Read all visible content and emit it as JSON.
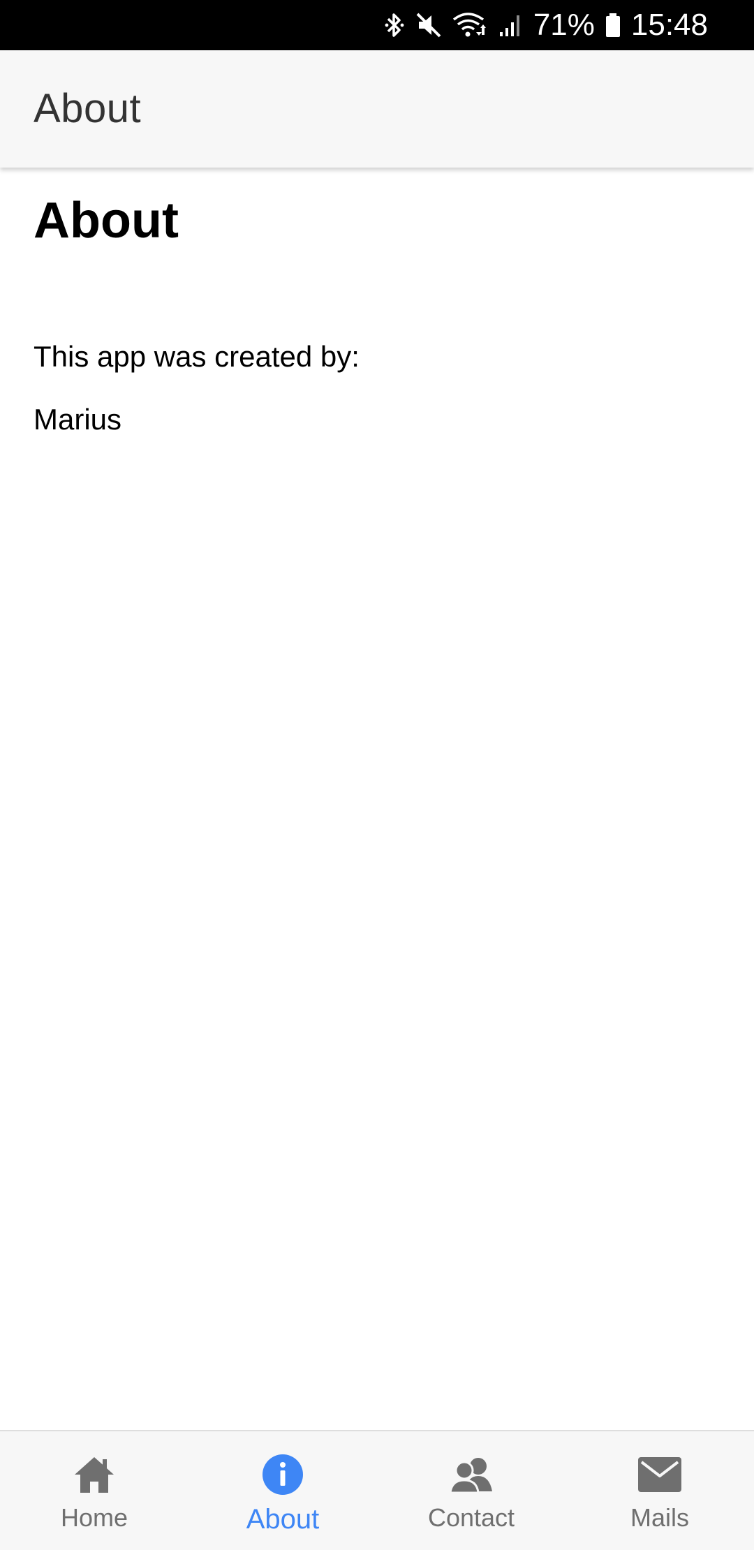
{
  "status_bar": {
    "battery_percent": "71%",
    "time": "15:48",
    "icons": [
      "bluetooth-icon",
      "mute-icon",
      "wifi-icon",
      "signal-icon",
      "battery-icon"
    ]
  },
  "app_bar": {
    "title": "About"
  },
  "content": {
    "heading": "About",
    "created_by_text": "This app was created by:",
    "author": "Marius"
  },
  "tabs": [
    {
      "label": "Home",
      "icon": "home-icon",
      "active": false
    },
    {
      "label": "About",
      "icon": "info-icon",
      "active": true
    },
    {
      "label": "Contact",
      "icon": "contact-icon",
      "active": false
    },
    {
      "label": "Mails",
      "icon": "mail-icon",
      "active": false
    }
  ],
  "colors": {
    "accent": "#3e86f5",
    "inactive_tab": "#6f6f6f",
    "app_bar_bg": "#f7f7f7",
    "status_bar_bg": "#000000"
  }
}
